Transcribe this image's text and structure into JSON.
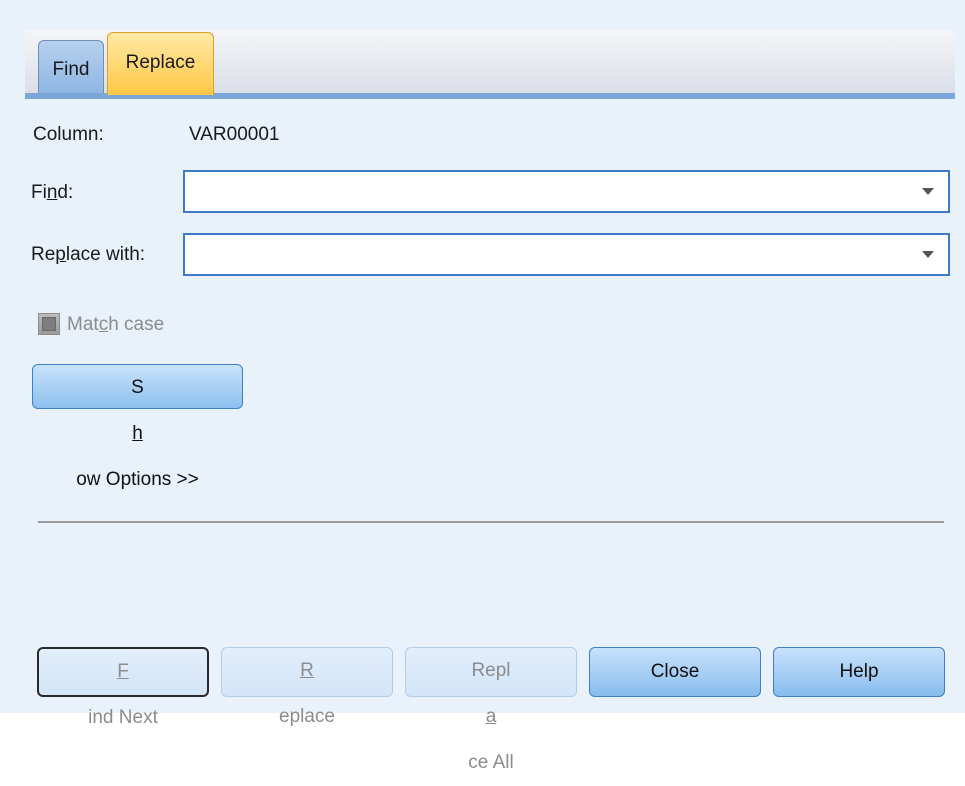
{
  "tabs": [
    {
      "label": "Find",
      "selected": false
    },
    {
      "label": "Replace",
      "selected": true
    }
  ],
  "column": {
    "label": "Column:",
    "value": "VAR00001"
  },
  "find": {
    "label_pre": "Fi",
    "label_mnemonic": "n",
    "label_post": "d:",
    "value": ""
  },
  "replace_with": {
    "label_pre": "Re",
    "label_mnemonic": "p",
    "label_post": "lace with:",
    "value": ""
  },
  "match_case": {
    "label_pre": "Mat",
    "label_mnemonic": "c",
    "label_post": "h case",
    "checked": false,
    "enabled": false
  },
  "show_options": {
    "label_pre": "S",
    "label_mnemonic": "h",
    "label_post": "ow Options >>"
  },
  "buttons": {
    "find_next": {
      "mnemonic": "F",
      "rest": "ind Next",
      "enabled": false
    },
    "replace": {
      "mnemonic": "R",
      "rest": "eplace",
      "enabled": false
    },
    "replace_all": {
      "pre": "Repl",
      "mnemonic": "a",
      "post": "ce All",
      "enabled": false
    },
    "close": {
      "label": "Close",
      "enabled": true
    },
    "help": {
      "label": "Help",
      "enabled": true
    }
  },
  "icons": {
    "dropdown": "chevron-down-icon",
    "checkbox": "checkbox-icon"
  },
  "colors": {
    "selected_tab": "#ffc844",
    "tab": "#8fb6e3",
    "accent": "#3d7bc7",
    "disabled_text": "#8c8c8c"
  }
}
